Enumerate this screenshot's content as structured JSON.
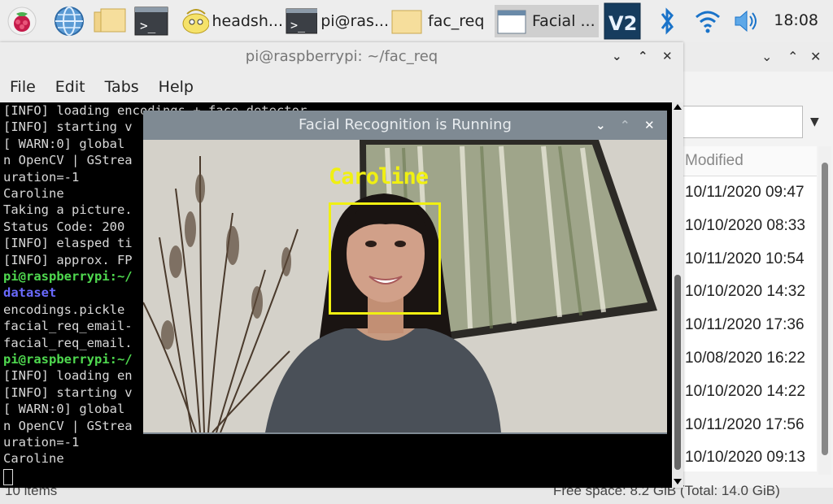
{
  "taskbar": {
    "tasks": [
      {
        "label": "headsh..."
      },
      {
        "label": "pi@ras..."
      },
      {
        "label": "fac_req"
      },
      {
        "label": "Facial ..."
      }
    ],
    "clock": "18:08"
  },
  "terminal": {
    "title": "pi@raspberrypi: ~/fac_req",
    "menu": [
      "File",
      "Edit",
      "Tabs",
      "Help"
    ],
    "lines": [
      "[INFO] loading encodings + face detector...",
      "[INFO] starting v",
      "[ WARN:0] global",
      "n OpenCV | GStrea",
      "uration=-1",
      "Caroline",
      "Taking a picture.",
      "Status Code: 200",
      "[INFO] elasped ti",
      "[INFO] approx. FP",
      "pi@raspberrypi:~/",
      "dataset",
      "encodings.pickle",
      "facial_req_email-",
      "facial_req_email.",
      "pi@raspberrypi:~/",
      "[INFO] loading en",
      "[INFO] starting v",
      "[ WARN:0] global",
      "n OpenCV | GStrea",
      "uration=-1",
      "Caroline"
    ]
  },
  "file_manager": {
    "column_header": "Modified",
    "dates": [
      "10/11/2020 09:47",
      "10/10/2020 08:33",
      "10/11/2020 10:54",
      "10/10/2020 14:32",
      "10/11/2020 17:36",
      "10/08/2020 16:22",
      "10/10/2020 14:22",
      "10/11/2020 17:56",
      "10/10/2020 09:13"
    ],
    "status_left": "10 items",
    "status_right": "Free space: 8.2 GiB (Total: 14.0 GiB)"
  },
  "facial_window": {
    "title": "Facial Recognition is Running",
    "detected_name": "Caroline"
  }
}
